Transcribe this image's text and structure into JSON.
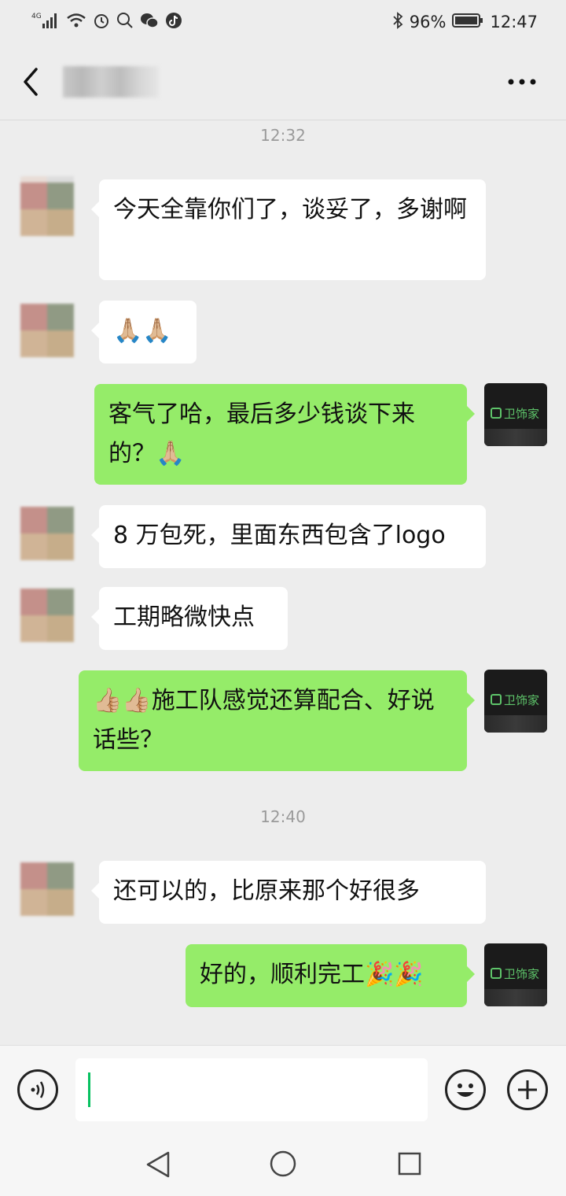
{
  "status_bar": {
    "network": "4G",
    "battery": "96%",
    "time": "12:47"
  },
  "header": {
    "contact_name": "",
    "back_icon": "chevron-left-icon",
    "more_icon": "more-dots-icon"
  },
  "chat": {
    "timestamps": [
      "12:32",
      "12:40"
    ],
    "messages": [
      {
        "side": "left",
        "text": "今天全靠你们了，谈妥了，多谢啊"
      },
      {
        "side": "left",
        "text": "🙏🏼🙏🏼"
      },
      {
        "side": "right",
        "text": "客气了哈，最后多少钱谈下来的？🙏🏼"
      },
      {
        "side": "left",
        "text": "8 万包死，里面东西包含了logo"
      },
      {
        "side": "left",
        "text": "工期略微快点"
      },
      {
        "side": "right",
        "text": "👍🏼👍🏼施工队感觉还算配合、好说话些？"
      },
      {
        "side": "left",
        "text": "还可以的，比原来那个好很多"
      },
      {
        "side": "right",
        "text": "好的，顺利完工🎉🎉"
      }
    ],
    "my_avatar_text": "卫饰家"
  },
  "input_bar": {
    "value": "",
    "voice_icon": "voice-icon",
    "emoji_icon": "emoji-icon",
    "plus_icon": "plus-icon"
  },
  "nav": {
    "back_icon": "nav-back-icon",
    "home_icon": "nav-home-icon",
    "recent_icon": "nav-recent-icon"
  },
  "colors": {
    "background": "#ededed",
    "my_bubble": "#95ec69",
    "their_bubble": "#ffffff",
    "caret": "#07c160"
  }
}
